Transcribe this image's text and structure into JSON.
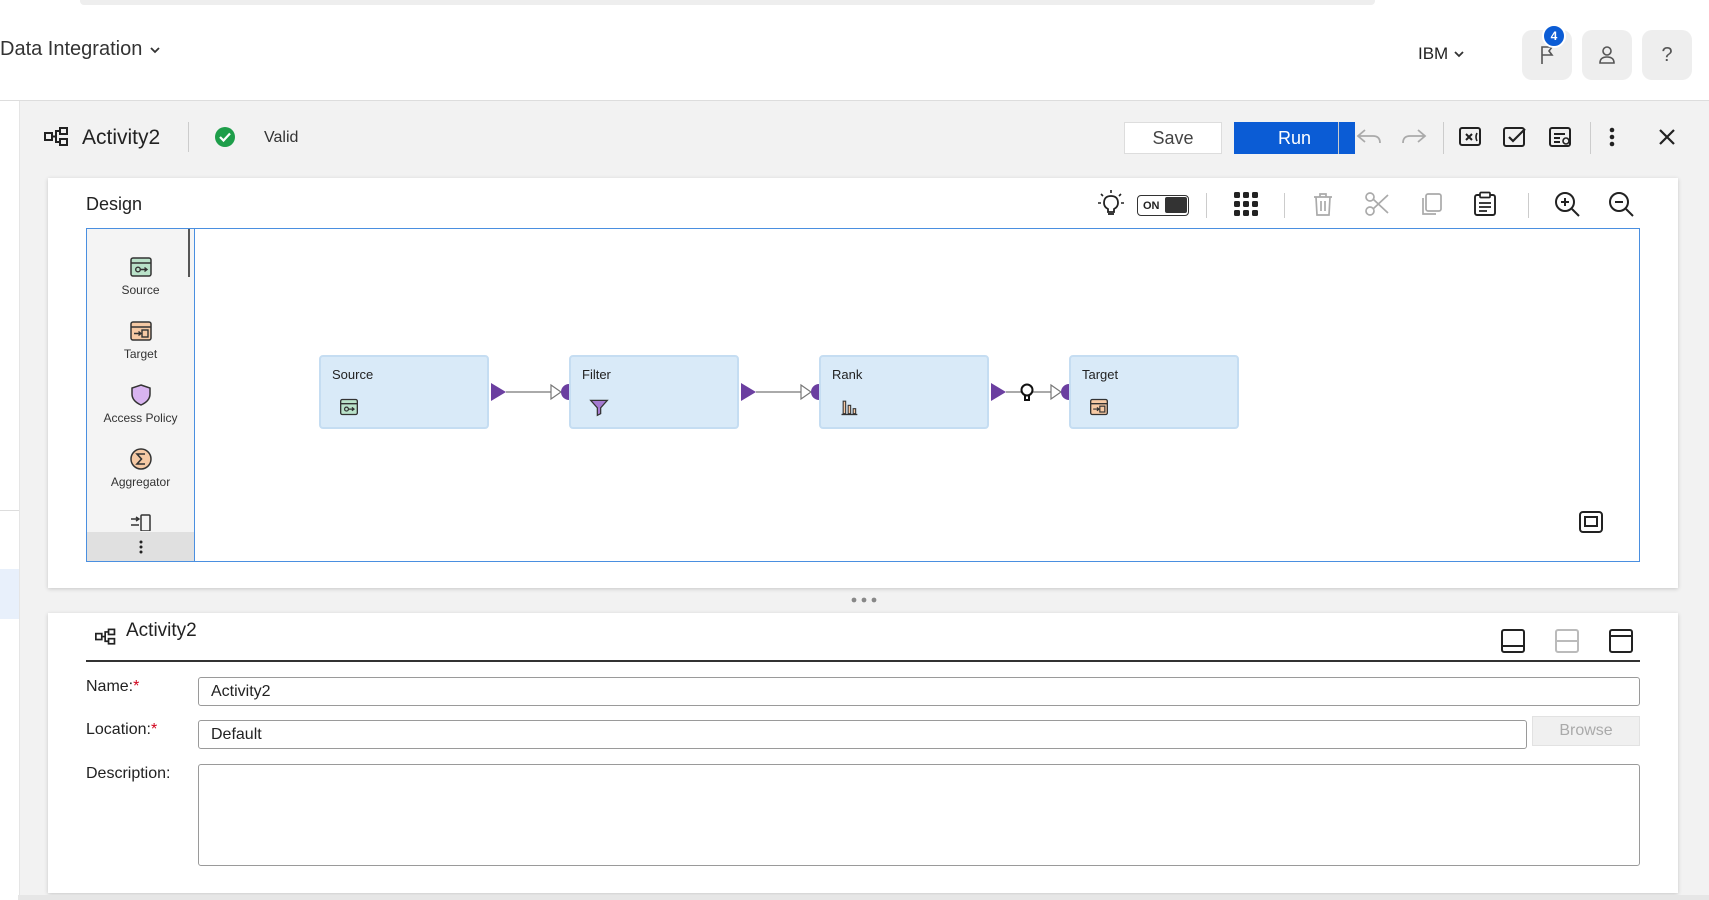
{
  "header": {
    "app_title": "Data Integration",
    "org_label": "IBM",
    "notification_count": "4",
    "help_label": "?"
  },
  "activity": {
    "name": "Activity2",
    "status": "Valid",
    "save_label": "Save",
    "run_label": "Run"
  },
  "design": {
    "title": "Design",
    "toggle_label": "ON",
    "palette": [
      {
        "label": "Source",
        "icon": "source-icon"
      },
      {
        "label": "Target",
        "icon": "target-icon"
      },
      {
        "label": "Access Policy",
        "icon": "shield-icon"
      },
      {
        "label": "Aggregator",
        "icon": "sigma-icon"
      }
    ],
    "nodes": [
      {
        "label": "Source",
        "icon": "source-icon"
      },
      {
        "label": "Filter",
        "icon": "filter-icon"
      },
      {
        "label": "Rank",
        "icon": "rank-icon"
      },
      {
        "label": "Target",
        "icon": "target-icon"
      }
    ]
  },
  "properties": {
    "title": "Activity2",
    "name_label": "Name:",
    "name_value": "Activity2",
    "location_label": "Location:",
    "location_value": "Default",
    "browse_label": "Browse",
    "description_label": "Description:",
    "description_value": "",
    "required_mark": "*"
  },
  "colors": {
    "accent": "#0b5cd5",
    "valid": "#1e9e4a",
    "link": "#6b3fa0",
    "node_fill": "#d9eaf8"
  }
}
